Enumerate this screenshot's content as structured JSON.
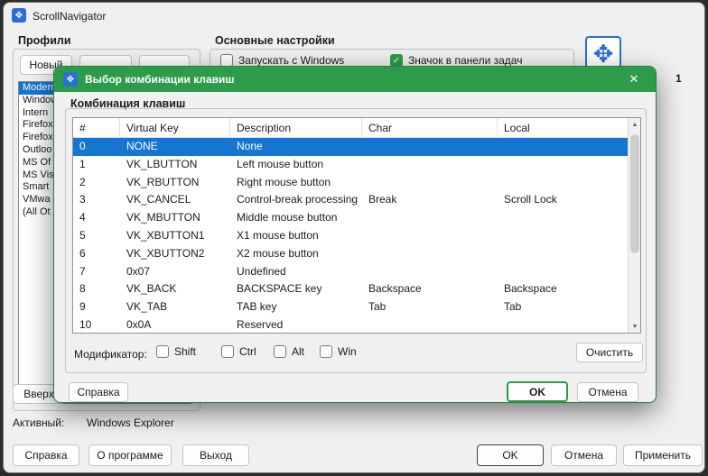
{
  "icons": {
    "app": "✥",
    "close": "✕",
    "check": "✓",
    "scroll_up": "▲",
    "scroll_down": "▼"
  },
  "window": {
    "title": "ScrollNavigator",
    "profiles": {
      "label": "Профили",
      "new_button": "Новый",
      "items": [
        "Modern",
        "Window",
        "Intern",
        "Firefox",
        "Firefox",
        "Outloo",
        "MS Of",
        "MS Vis",
        "Smart",
        "VMwa",
        "(All Ot"
      ],
      "selected_index": 0
    },
    "settings": {
      "label": "Основные настройки",
      "run_with_windows": {
        "label": "Запускать с Windows",
        "checked": false
      },
      "taskbar_icon": {
        "label": "Значок в панели задач",
        "checked": true
      }
    },
    "fragment_one": "1",
    "up_button": "Вверх",
    "active": {
      "label": "Активный:",
      "value": "Windows Explorer"
    },
    "footer": {
      "help": "Справка",
      "about": "О программе",
      "exit": "Выход",
      "ok": "OK",
      "cancel": "Отмена",
      "apply": "Применить"
    }
  },
  "dialog": {
    "title": "Выбор комбинации клавиш",
    "group_label": "Комбинация клавиш",
    "table": {
      "headers": [
        "#",
        "Virtual Key",
        "Description",
        "Char",
        "Local"
      ],
      "selected_index": 0,
      "rows": [
        [
          "0",
          "NONE",
          "None",
          "",
          ""
        ],
        [
          "1",
          "VK_LBUTTON",
          "Left mouse button",
          "",
          ""
        ],
        [
          "2",
          "VK_RBUTTON",
          "Right mouse button",
          "",
          ""
        ],
        [
          "3",
          "VK_CANCEL",
          "Control-break processing",
          "Break",
          "Scroll Lock"
        ],
        [
          "4",
          "VK_MBUTTON",
          "Middle mouse button",
          "",
          ""
        ],
        [
          "5",
          "VK_XBUTTON1",
          "X1 mouse button",
          "",
          ""
        ],
        [
          "6",
          "VK_XBUTTON2",
          "X2 mouse button",
          "",
          ""
        ],
        [
          "7",
          "0x07",
          "Undefined",
          "",
          ""
        ],
        [
          "8",
          "VK_BACK",
          "BACKSPACE key",
          "Backspace",
          "Backspace"
        ],
        [
          "9",
          "VK_TAB",
          "TAB key",
          "Tab",
          "Tab"
        ],
        [
          "10",
          "0x0A",
          "Reserved",
          "",
          ""
        ]
      ]
    },
    "modifier": {
      "label": "Модификатор:",
      "options": [
        "Shift",
        "Ctrl",
        "Alt",
        "Win"
      ]
    },
    "clear_button": "Очистить",
    "help_button": "Справка",
    "ok_button": "OK",
    "cancel_button": "Отмена"
  },
  "colors": {
    "accent_green": "#2d9c4a",
    "selection_blue": "#1576d2"
  }
}
